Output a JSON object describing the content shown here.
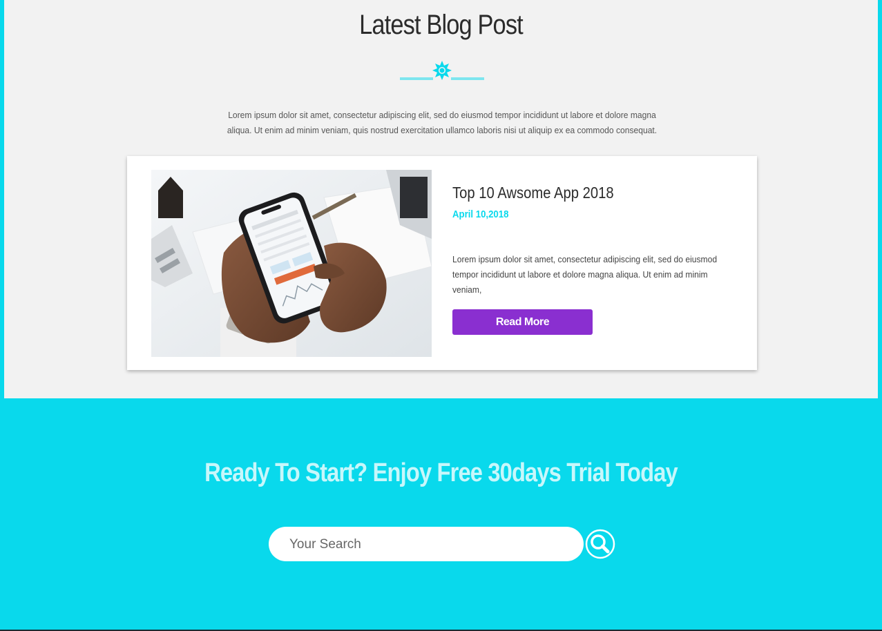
{
  "blog": {
    "title": "Latest Blog Post",
    "intro": "Lorem ipsum dolor sit amet, consectetur adipiscing elit, sed do eiusmod tempor incididunt ut labore et dolore magna aliqua. Ut enim ad minim veniam, quis nostrud exercitation ullamco laboris nisi ut aliquip ex ea commodo consequat.",
    "post": {
      "title": "Top 10 Awsome App 2018",
      "date": "April 10,2018",
      "excerpt": "Lorem ipsum dolor sit amet, consectetur adipiscing elit, sed do eiusmod tempor incididunt ut labore et dolore magna aliqua. Ut enim ad minim veniam,",
      "button_label": "Read More"
    }
  },
  "cta": {
    "title": "Ready To Start? Enjoy Free 30days Trial Today",
    "search_placeholder": "Your Search"
  },
  "colors": {
    "accent_cyan": "#09d9ec",
    "button_purple": "#8a2fd0",
    "section_bg": "#f2f2f2"
  },
  "icons": {
    "divider": "star-divider-icon",
    "search": "search-icon"
  }
}
